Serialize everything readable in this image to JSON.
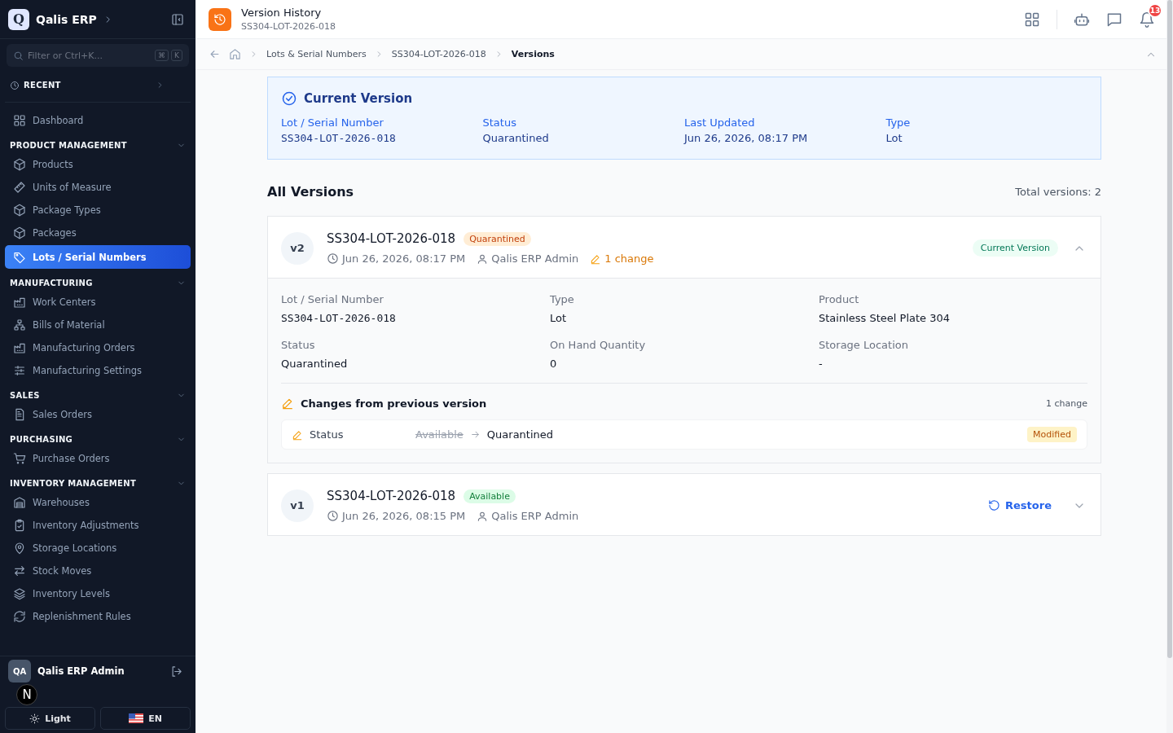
{
  "app": {
    "logo_letter": "Q",
    "name": "Qalis ERP"
  },
  "sidebar": {
    "search": {
      "placeholder": "Filter or Ctrl+K...",
      "keys": [
        "⌘",
        "K"
      ]
    },
    "recent": {
      "label": "RECENT"
    },
    "items": [
      {
        "kind": "item",
        "label": "Dashboard",
        "selected": false
      },
      {
        "kind": "section",
        "label": "PRODUCT MANAGEMENT",
        "expanded": true
      },
      {
        "kind": "item",
        "label": "Products",
        "selected": false
      },
      {
        "kind": "item",
        "label": "Units of Measure",
        "selected": false
      },
      {
        "kind": "item",
        "label": "Package Types",
        "selected": false
      },
      {
        "kind": "item",
        "label": "Packages",
        "selected": false
      },
      {
        "kind": "item",
        "label": "Lots / Serial Numbers",
        "selected": true
      },
      {
        "kind": "section",
        "label": "MANUFACTURING",
        "expanded": true
      },
      {
        "kind": "item",
        "label": "Work Centers",
        "selected": false
      },
      {
        "kind": "item",
        "label": "Bills of Material",
        "selected": false
      },
      {
        "kind": "item",
        "label": "Manufacturing Orders",
        "selected": false
      },
      {
        "kind": "item",
        "label": "Manufacturing Settings",
        "selected": false
      },
      {
        "kind": "section",
        "label": "SALES",
        "expanded": true
      },
      {
        "kind": "item",
        "label": "Sales Orders",
        "selected": false
      },
      {
        "kind": "section",
        "label": "PURCHASING",
        "expanded": true
      },
      {
        "kind": "item",
        "label": "Purchase Orders",
        "selected": false
      },
      {
        "kind": "section",
        "label": "INVENTORY MANAGEMENT",
        "expanded": true
      },
      {
        "kind": "item",
        "label": "Warehouses",
        "selected": false
      },
      {
        "kind": "item",
        "label": "Inventory Adjustments",
        "selected": false
      },
      {
        "kind": "item",
        "label": "Storage Locations",
        "selected": false
      },
      {
        "kind": "item",
        "label": "Stock Moves",
        "selected": false
      },
      {
        "kind": "item",
        "label": "Inventory Levels",
        "selected": false
      },
      {
        "kind": "item",
        "label": "Replenishment Rules",
        "selected": false
      }
    ],
    "user": {
      "initials": "QA",
      "name": "Qalis ERP Admin"
    },
    "theme_button": "Light",
    "language_button": "EN",
    "dev_indicator": "N"
  },
  "header": {
    "title": "Version History",
    "subtitle": "SS304-LOT-2026-018",
    "notification_count": "13"
  },
  "breadcrumb": [
    {
      "label": "Lots & Serial Numbers",
      "current": false
    },
    {
      "label": "SS304-LOT-2026-018",
      "current": false
    },
    {
      "label": "Versions",
      "current": true
    }
  ],
  "current_version": {
    "title": "Current Version",
    "fields": [
      {
        "label": "Lot / Serial Number",
        "value": "SS304-LOT-2026-018",
        "kind": "mono"
      },
      {
        "label": "Status",
        "value": "Quarantined",
        "kind": "text"
      },
      {
        "label": "Last Updated",
        "value": "Jun 26, 2026, 08:17 PM",
        "kind": "text"
      },
      {
        "label": "Type",
        "value": "Lot",
        "kind": "text"
      }
    ]
  },
  "versions_heading": "All Versions",
  "total_versions": "Total versions: 2",
  "versions": [
    {
      "badge": "v2",
      "serial": "SS304-LOT-2026-018",
      "status": {
        "label": "Quarantined",
        "kind": "warning"
      },
      "timestamp": "Jun 26, 2026, 08:17 PM",
      "author": "Qalis ERP Admin",
      "change_count": "1 change",
      "current_label": "Current Version",
      "expanded": true,
      "details": [
        {
          "label": "Lot / Serial Number",
          "value": "SS304-LOT-2026-018",
          "kind": "mono"
        },
        {
          "label": "Type",
          "value": "Lot",
          "kind": "text"
        },
        {
          "label": "Product",
          "value": "Stainless Steel Plate 304",
          "kind": "text"
        },
        {
          "label": "Status",
          "value": "Quarantined",
          "kind": "text"
        },
        {
          "label": "On Hand Quantity",
          "value": "0",
          "kind": "text"
        },
        {
          "label": "Storage Location",
          "value": "-",
          "kind": "text"
        }
      ],
      "changes": {
        "title": "Changes from previous version",
        "count": "1 change",
        "items": [
          {
            "field": "Status",
            "old": "Available",
            "new": "Quarantined",
            "tag": "Modified"
          }
        ]
      }
    },
    {
      "badge": "v1",
      "serial": "SS304-LOT-2026-018",
      "status": {
        "label": "Available",
        "kind": "success"
      },
      "timestamp": "Jun 26, 2026, 08:15 PM",
      "author": "Qalis ERP Admin",
      "restore_label": "Restore",
      "expanded": false
    }
  ]
}
